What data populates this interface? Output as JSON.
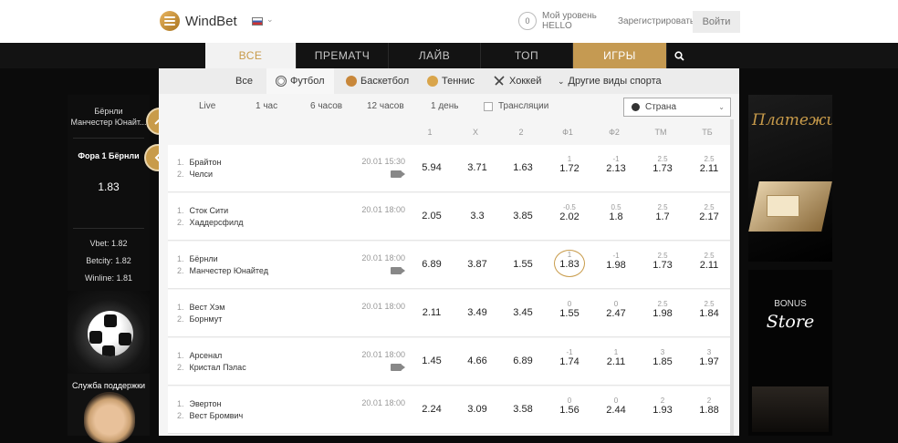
{
  "header": {
    "brand": "WindBet",
    "level_count": "0",
    "level_label": "Мой уровень",
    "level_value": "HELLO",
    "register": "Зарегистрироваться",
    "login": "Войти"
  },
  "nav": {
    "tabs": [
      "ВСЕ",
      "ПРЕМАТЧ",
      "ЛАЙВ",
      "ТОП",
      "ИГРЫ"
    ]
  },
  "sports": {
    "all": "Все",
    "football": "Футбол",
    "basketball": "Баскетбол",
    "tennis": "Теннис",
    "hockey": "Хоккей",
    "other": "Другие виды спорта"
  },
  "filters": {
    "live": "Live",
    "h1": "1 час",
    "h6": "6 часов",
    "h12": "12 часов",
    "d1": "1 день",
    "broadcasts": "Трансляции",
    "country": "Страна"
  },
  "columns": [
    "1",
    "X",
    "2",
    "Ф1",
    "Ф2",
    "ТМ",
    "ТБ"
  ],
  "matches": [
    {
      "team1": "Брайтон",
      "team2": "Челси",
      "date": "20.01",
      "time": "15:30",
      "video": true,
      "o1": "5.94",
      "ox": "3.71",
      "o2": "1.63",
      "f1h": "1",
      "f1": "1.72",
      "f2h": "-1",
      "f2": "2.13",
      "tmh": "2.5",
      "tm": "1.73",
      "tbh": "2.5",
      "tb": "2.11"
    },
    {
      "team1": "Сток Сити",
      "team2": "Хаддерсфилд",
      "date": "20.01",
      "time": "18:00",
      "video": false,
      "o1": "2.05",
      "ox": "3.3",
      "o2": "3.85",
      "f1h": "-0.5",
      "f1": "2.02",
      "f2h": "0.5",
      "f2": "1.8",
      "tmh": "2.5",
      "tm": "1.7",
      "tbh": "2.5",
      "tb": "2.17"
    },
    {
      "team1": "Бёрнли",
      "team2": "Манчестер Юнайтед",
      "date": "20.01",
      "time": "18:00",
      "video": true,
      "o1": "6.89",
      "ox": "3.87",
      "o2": "1.55",
      "f1h": "1",
      "f1": "1.83",
      "f2h": "-1",
      "f2": "1.98",
      "tmh": "2.5",
      "tm": "1.73",
      "tbh": "2.5",
      "tb": "2.11"
    },
    {
      "team1": "Вест Хэм",
      "team2": "Борнмут",
      "date": "20.01",
      "time": "18:00",
      "video": false,
      "o1": "2.11",
      "ox": "3.49",
      "o2": "3.45",
      "f1h": "0",
      "f1": "1.55",
      "f2h": "0",
      "f2": "2.47",
      "tmh": "2.5",
      "tm": "1.98",
      "tbh": "2.5",
      "tb": "1.84"
    },
    {
      "team1": "Арсенал",
      "team2": "Кристал Пэлас",
      "date": "20.01",
      "time": "18:00",
      "video": true,
      "o1": "1.45",
      "ox": "4.66",
      "o2": "6.89",
      "f1h": "-1",
      "f1": "1.74",
      "f2h": "1",
      "f2": "2.11",
      "tmh": "3",
      "tm": "1.85",
      "tbh": "3",
      "tb": "1.97"
    },
    {
      "team1": "Эвертон",
      "team2": "Вест Бромвич",
      "date": "20.01",
      "time": "18:00",
      "video": false,
      "o1": "2.24",
      "ox": "3.09",
      "o2": "3.58",
      "f1h": "0",
      "f1": "1.56",
      "f2h": "0",
      "f2": "2.44",
      "tmh": "2",
      "tm": "1.93",
      "tbh": "2",
      "tb": "1.88"
    }
  ],
  "left_panel": {
    "match_line1": "Бёрнли",
    "match_line2": "Манчестер Юнайт...",
    "bet": "Фора 1 Бёрнли",
    "bet_value": "1.83",
    "comparisons": [
      "Vbet: 1.82",
      "Betcity: 1.82",
      "Winline: 1.81"
    ],
    "support": "Служба поддержки"
  },
  "right_panel": {
    "payments": "Платежи",
    "bonus": "BONUS",
    "store": "Store"
  },
  "colors": {
    "accent": "#c89b4a",
    "nav_bg": "#131313"
  }
}
